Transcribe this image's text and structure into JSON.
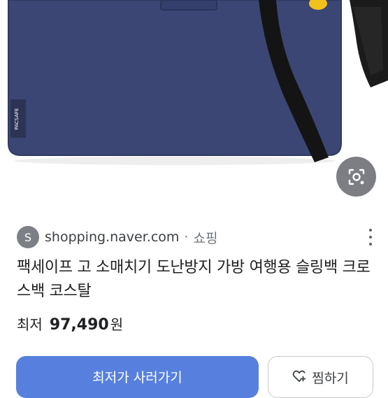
{
  "product_image": {
    "alt": "",
    "lens_icon": "image-search-icon"
  },
  "source": {
    "avatar_letter": "S",
    "domain": "shopping.naver.com",
    "separator": "·",
    "category": "쇼핑",
    "more_icon": "more-vert-icon"
  },
  "product": {
    "title": "팩세이프 고 소매치기 도난방지 가방 여행용 슬링백 크로스백 코스탈",
    "price_label": "최저",
    "price_value": "97,490",
    "price_unit": "원"
  },
  "actions": {
    "buy_label": "최저가 사러가기",
    "wish_label": "찜하기",
    "wish_icon": "heart-plus-icon"
  },
  "colors": {
    "bag_navy": "#3a4672",
    "accent_blue": "#5780de",
    "lens_bg": "#7d7e83"
  }
}
